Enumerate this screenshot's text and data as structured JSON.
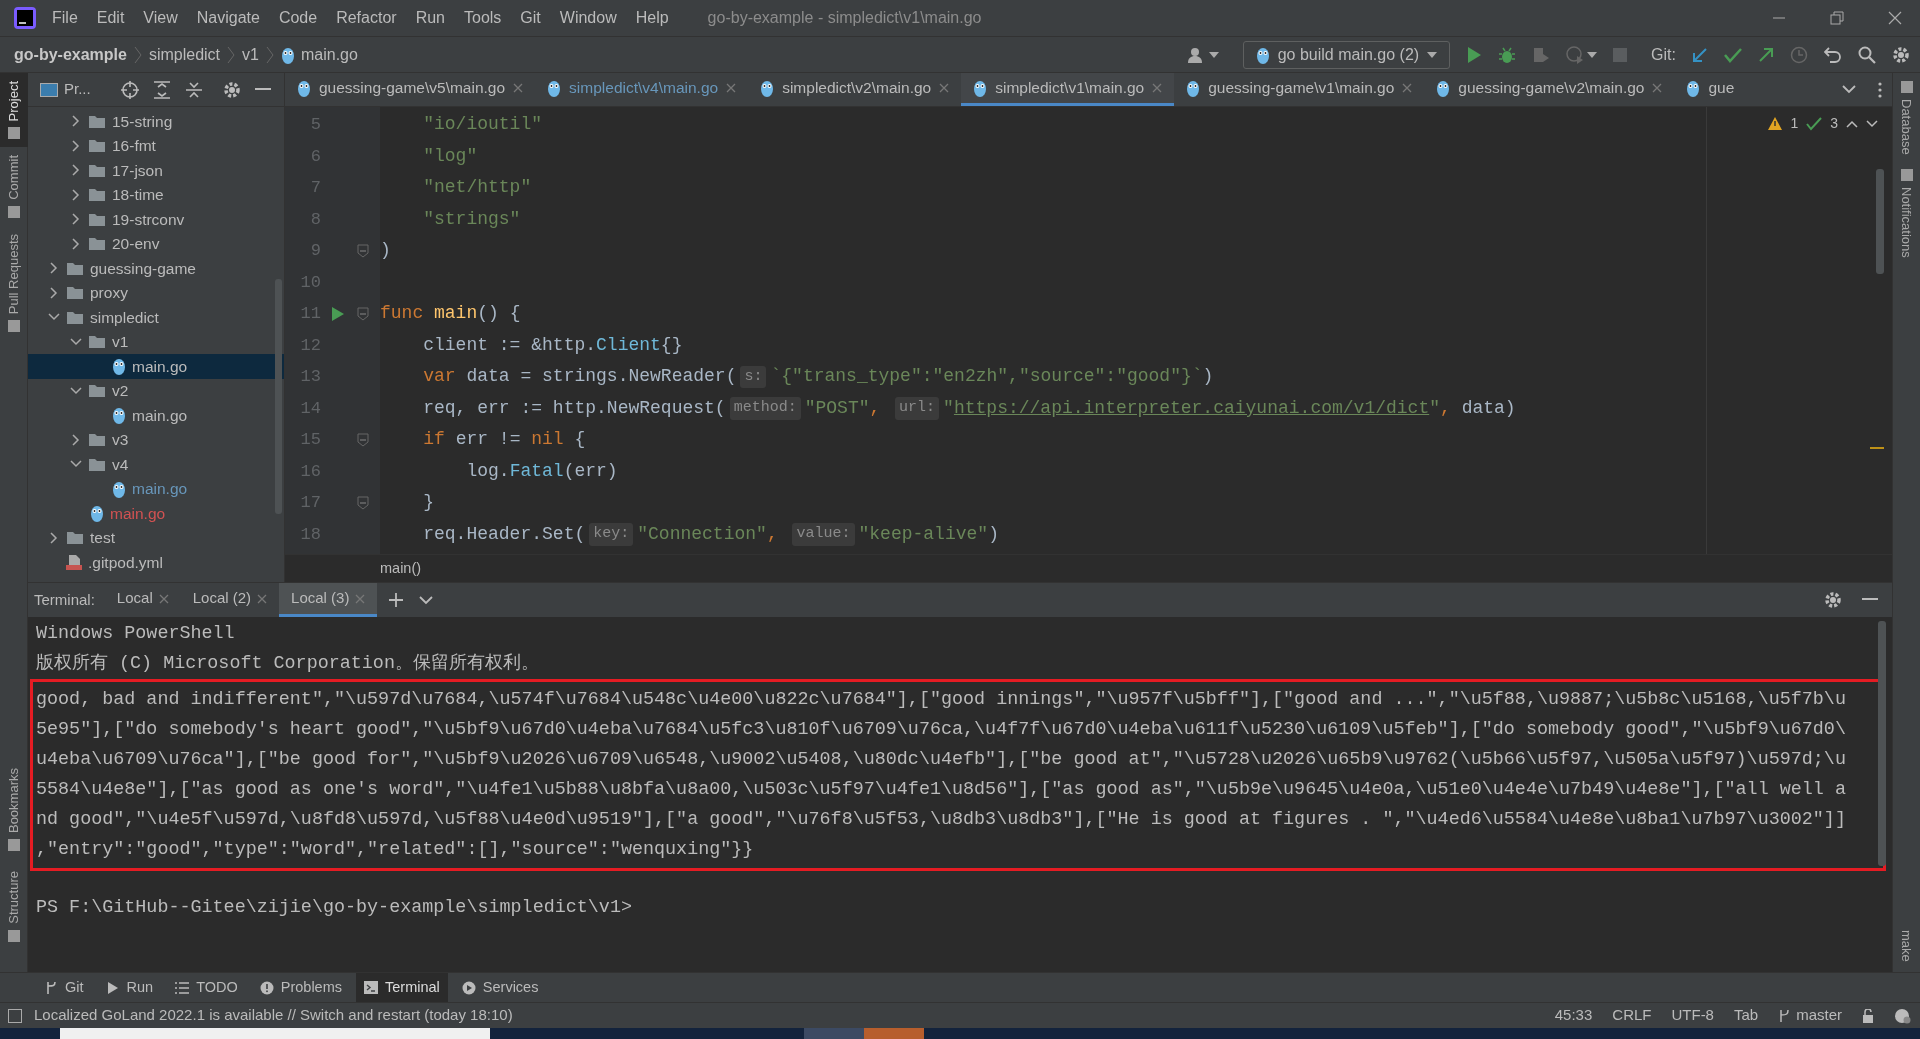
{
  "window": {
    "title": "go-by-example - simpledict\\v1\\main.go"
  },
  "menu": [
    "File",
    "Edit",
    "View",
    "Navigate",
    "Code",
    "Refactor",
    "Run",
    "Tools",
    "Git",
    "Window",
    "Help"
  ],
  "breadcrumb": [
    "go-by-example",
    "simpledict",
    "v1",
    "main.go"
  ],
  "toolbar": {
    "run_config": "go build main.go (2)",
    "git_label": "Git:"
  },
  "left_strip": [
    {
      "label": "Project",
      "selected": true
    },
    {
      "label": "Commit",
      "selected": false
    },
    {
      "label": "Pull Requests",
      "selected": false
    }
  ],
  "left_strip_bottom": [
    {
      "label": "Bookmarks"
    },
    {
      "label": "Structure"
    }
  ],
  "right_strip": [
    {
      "label": "Database"
    },
    {
      "label": "Notifications"
    }
  ],
  "right_strip_bottom": [
    {
      "label": "make"
    }
  ],
  "project_panel": {
    "title": "Pr...",
    "partial_group": [
      {
        "label": "15-string",
        "kind": "folder",
        "expanded": false,
        "selected": false
      },
      {
        "label": "16-fmt",
        "kind": "folder",
        "expanded": false,
        "selected": false
      },
      {
        "label": "17-json",
        "kind": "folder",
        "expanded": false,
        "selected": false
      },
      {
        "label": "18-time",
        "kind": "folder",
        "expanded": false,
        "selected": false
      },
      {
        "label": "19-strconv",
        "kind": "folder",
        "expanded": false,
        "selected": false
      },
      {
        "label": "20-env",
        "kind": "folder",
        "expanded": false,
        "selected": false
      }
    ],
    "items": [
      {
        "label": "guessing-game",
        "kind": "folder",
        "expanded": false,
        "selected": false
      },
      {
        "label": "proxy",
        "kind": "folder",
        "expanded": false,
        "selected": false
      },
      {
        "label": "simpledict",
        "kind": "folder",
        "expanded": true,
        "selected": false,
        "children": [
          {
            "label": "v1",
            "kind": "folder",
            "expanded": true,
            "selected": false,
            "children": [
              {
                "label": "main.go",
                "kind": "file",
                "selected": true
              }
            ]
          },
          {
            "label": "v2",
            "kind": "folder",
            "expanded": true,
            "selected": false,
            "children": [
              {
                "label": "main.go",
                "kind": "file",
                "selected": false
              }
            ]
          },
          {
            "label": "v3",
            "kind": "folder",
            "expanded": false,
            "selected": false
          },
          {
            "label": "v4",
            "kind": "folder",
            "expanded": true,
            "selected": false,
            "children": [
              {
                "label": "main.go",
                "kind": "file",
                "selected": false,
                "color": "#6897bb"
              }
            ]
          },
          {
            "label": "main.go",
            "kind": "file",
            "selected": false,
            "color": "#d25252"
          }
        ]
      },
      {
        "label": "test",
        "kind": "folder",
        "expanded": false,
        "selected": false
      },
      {
        "label": ".gitpod.yml",
        "kind": "yml",
        "selected": false
      }
    ]
  },
  "editor_tabs": [
    {
      "label": "guessing-game\\v5\\main.go",
      "selected": false
    },
    {
      "label": "simpledict\\v4\\main.go",
      "selected": false,
      "color": "#6897bb"
    },
    {
      "label": "simpledict\\v2\\main.go",
      "selected": false
    },
    {
      "label": "simpledict\\v1\\main.go",
      "selected": true
    },
    {
      "label": "guessing-game\\v1\\main.go",
      "selected": false
    },
    {
      "label": "guessing-game\\v2\\main.go",
      "selected": false
    },
    {
      "label": "gue",
      "selected": false,
      "cut": true
    }
  ],
  "inspections": {
    "warnings": "1",
    "weak_warnings": "3"
  },
  "code": [
    {
      "number": "5",
      "run": false,
      "fold": false,
      "tokens": [
        {
          "kind": "str",
          "text": "    \"io/ioutil\""
        }
      ]
    },
    {
      "number": "6",
      "run": false,
      "fold": false,
      "tokens": [
        {
          "kind": "str",
          "text": "    \"log\""
        }
      ]
    },
    {
      "number": "7",
      "run": false,
      "fold": false,
      "tokens": [
        {
          "kind": "str",
          "text": "    \"net/http\""
        }
      ]
    },
    {
      "number": "8",
      "run": false,
      "fold": false,
      "tokens": [
        {
          "kind": "str",
          "text": "    \"strings\""
        }
      ]
    },
    {
      "number": "9",
      "run": false,
      "fold": true,
      "tokens": [
        {
          "kind": "plain",
          "text": ")"
        }
      ]
    },
    {
      "number": "10",
      "run": false,
      "fold": false
    },
    {
      "number": "11",
      "run": true,
      "fold": true,
      "tokens": [
        {
          "kind": "kw",
          "text": "func "
        },
        {
          "kind": "fn",
          "text": "main"
        },
        {
          "kind": "plain",
          "text": "() {"
        }
      ]
    },
    {
      "number": "12",
      "run": false,
      "fold": false,
      "tokens": [
        {
          "kind": "plain",
          "text": "    client := &http."
        },
        {
          "kind": "member",
          "text": "Client"
        },
        {
          "kind": "plain",
          "text": "{}"
        }
      ]
    },
    {
      "number": "13",
      "run": false,
      "fold": false,
      "tokens": [
        {
          "kind": "kw",
          "text": "    var "
        },
        {
          "kind": "plain",
          "text": "data = strings.NewReader("
        },
        {
          "kind": "hint",
          "text": "s:"
        },
        {
          "kind": "str",
          "text": "`{\"trans_type\":\"en2zh\",\"source\":\"good\"}`"
        },
        {
          "kind": "plain",
          "text": ")"
        }
      ]
    },
    {
      "number": "14",
      "run": false,
      "fold": false,
      "tokens": [
        {
          "kind": "plain",
          "text": "    req, err := http.NewRequest("
        },
        {
          "kind": "hint",
          "text": "method:"
        },
        {
          "kind": "str",
          "text": "\"POST\""
        },
        {
          "kind": "kw",
          "text": ", "
        },
        {
          "kind": "hint",
          "text": "url:"
        },
        {
          "kind": "str",
          "text": "\""
        },
        {
          "kind": "link",
          "text": "https://api.interpreter.caiyunai.com/v1/dict"
        },
        {
          "kind": "str",
          "text": "\""
        },
        {
          "kind": "kw",
          "text": ", "
        },
        {
          "kind": "plain",
          "text": "data)"
        }
      ]
    },
    {
      "number": "15",
      "run": false,
      "fold": true,
      "tokens": [
        {
          "kind": "kw",
          "text": "    if "
        },
        {
          "kind": "plain",
          "text": "err != "
        },
        {
          "kind": "kw",
          "text": "nil "
        },
        {
          "kind": "plain",
          "text": "{"
        }
      ]
    },
    {
      "number": "16",
      "run": false,
      "fold": false,
      "tokens": [
        {
          "kind": "plain",
          "text": "        log."
        },
        {
          "kind": "member",
          "text": "Fatal"
        },
        {
          "kind": "plain",
          "text": "(err)"
        }
      ]
    },
    {
      "number": "17",
      "run": false,
      "fold": true,
      "tokens": [
        {
          "kind": "plain",
          "text": "    }"
        }
      ]
    },
    {
      "number": "18",
      "run": false,
      "fold": false,
      "tokens": [
        {
          "kind": "plain",
          "text": "    req.Header.Set("
        },
        {
          "kind": "hint",
          "text": "key:"
        },
        {
          "kind": "str",
          "text": "\"Connection\""
        },
        {
          "kind": "kw",
          "text": ", "
        },
        {
          "kind": "hint",
          "text": "value:"
        },
        {
          "kind": "str",
          "text": "\"keep-alive\""
        },
        {
          "kind": "plain",
          "text": ")"
        }
      ]
    }
  ],
  "editor_breadcrumb": "main()",
  "terminal": {
    "label": "Terminal:",
    "tabs": [
      {
        "label": "Local",
        "selected": false
      },
      {
        "label": "Local (2)",
        "selected": false
      },
      {
        "label": "Local (3)",
        "selected": true
      }
    ],
    "lines": [
      "Windows PowerShell",
      "版权所有 (C) Microsoft Corporation。保留所有权利。"
    ],
    "highlighted_block": [
      "good, bad and indifferent\",\"\\u597d\\u7684,\\u574f\\u7684\\u548c\\u4e00\\u822c\\u7684\"],[\"good innings\",\"\\u957f\\u5bff\"],[\"good and ...\",\"\\u5f88,\\u9887;\\u5b8c\\u5168,\\u5f7b\\u",
      "5e95\"],[\"do somebody's heart good\",\"\\u5bf9\\u67d0\\u4eba\\u7684\\u5fc3\\u810f\\u6709\\u76ca,\\u4f7f\\u67d0\\u4eba\\u611f\\u5230\\u6109\\u5feb\"],[\"do somebody good\",\"\\u5bf9\\u67d0\\",
      "u4eba\\u6709\\u76ca\"],[\"be good for\",\"\\u5bf9\\u2026\\u6709\\u6548,\\u9002\\u5408,\\u80dc\\u4efb\"],[\"be good at\",\"\\u5728\\u2026\\u65b9\\u9762(\\u5b66\\u5f97,\\u505a\\u5f97)\\u597d;\\u",
      "5584\\u4e8e\"],[\"as good as one's word\",\"\\u4fe1\\u5b88\\u8bfa\\u8a00,\\u503c\\u5f97\\u4fe1\\u8d56\"],[\"as good as\",\"\\u5b9e\\u9645\\u4e0a,\\u51e0\\u4e4e\\u7b49\\u4e8e\"],[\"all well a",
      "nd good\",\"\\u4e5f\\u597d,\\u8fd8\\u597d,\\u5f88\\u4e0d\\u9519\"],[\"a good\",\"\\u76f8\\u5f53,\\u8db3\\u8db3\"],[\"He is good at figures . \",\"\\u4ed6\\u5584\\u4e8e\\u8ba1\\u7b97\\u3002\"]]",
      ",\"entry\":\"good\",\"type\":\"word\",\"related\":[],\"source\":\"wenquxing\"}}"
    ],
    "prompt": "PS F:\\GitHub--Gitee\\zijie\\go-by-example\\simpledict\\v1>"
  },
  "tool_tabs": [
    {
      "label": "Git",
      "kind": "git",
      "selected": false
    },
    {
      "label": "Run",
      "kind": "run",
      "selected": false
    },
    {
      "label": "TODO",
      "kind": "todo",
      "selected": false
    },
    {
      "label": "Problems",
      "kind": "problems",
      "selected": false
    },
    {
      "label": "Terminal",
      "kind": "terminal",
      "selected": true
    },
    {
      "label": "Services",
      "kind": "services",
      "selected": false
    }
  ],
  "status_bar": {
    "message": "Localized GoLand 2022.1 is available // Switch and restart (today 18:10)",
    "position": "45:33",
    "line_separator": "CRLF",
    "encoding": "UTF-8",
    "indent": "Tab",
    "branch": "master"
  }
}
